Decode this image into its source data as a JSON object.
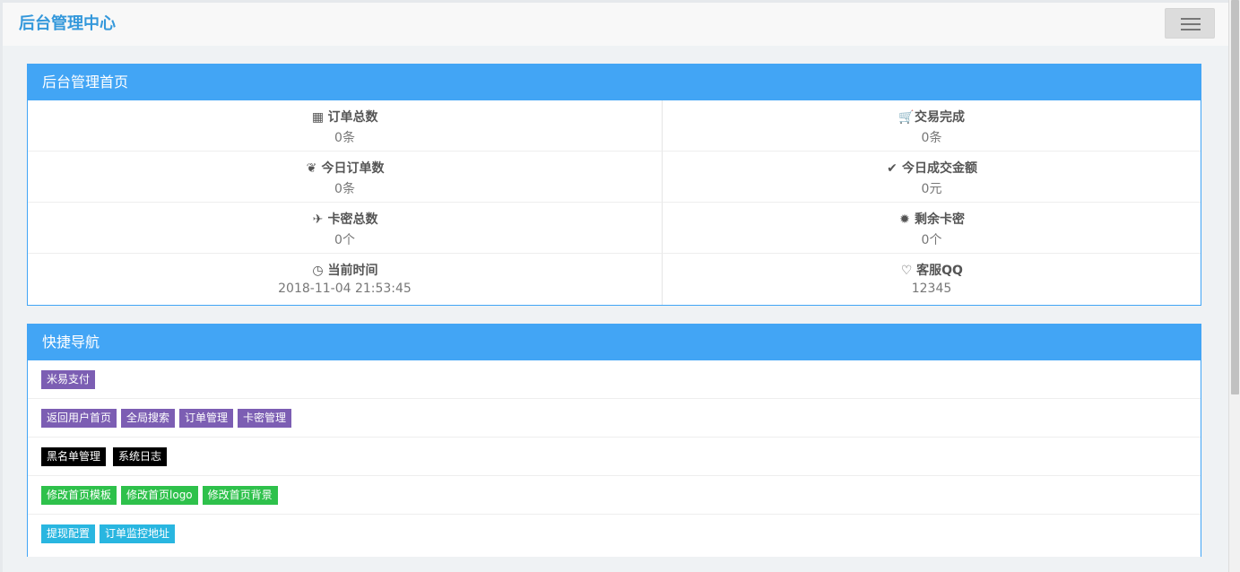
{
  "header": {
    "brand": "后台管理中心"
  },
  "dashboard": {
    "title": "后台管理首页",
    "stats": [
      {
        "icon": "grid-icon",
        "glyph": "▦",
        "label": "订单总数",
        "value": "0条"
      },
      {
        "icon": "cart-icon",
        "glyph": "🛒",
        "label": "交易完成",
        "value": "0条"
      },
      {
        "icon": "leaf-icon",
        "glyph": "❦",
        "label": "今日订单数",
        "value": "0条"
      },
      {
        "icon": "check-icon",
        "glyph": "✔",
        "label": "今日成交金额",
        "value": "0元"
      },
      {
        "icon": "plane-icon",
        "glyph": "✈",
        "label": "卡密总数",
        "value": "0个"
      },
      {
        "icon": "certificate-icon",
        "glyph": "✹",
        "label": "剩余卡密",
        "value": "0个"
      },
      {
        "icon": "clock-icon",
        "glyph": "◷",
        "label": "当前时间",
        "value": "2018-11-04 21:53:45"
      },
      {
        "icon": "heart-icon",
        "glyph": "♡",
        "label": "客服QQ",
        "value": "12345"
      }
    ]
  },
  "quicknav": {
    "title": "快捷导航",
    "rows": [
      [
        {
          "label": "米易支付",
          "color": "purple"
        }
      ],
      [
        {
          "label": "返回用户首页",
          "color": "purple"
        },
        {
          "label": "全局搜索",
          "color": "purple"
        },
        {
          "label": "订单管理",
          "color": "purple"
        },
        {
          "label": "卡密管理",
          "color": "purple"
        }
      ],
      [
        {
          "label": "黑名单管理",
          "color": "black"
        },
        {
          "label": "系统日志",
          "color": "black"
        }
      ],
      [
        {
          "label": "修改首页模板",
          "color": "green"
        },
        {
          "label": "修改首页logo",
          "color": "green"
        },
        {
          "label": "修改首页背景",
          "color": "green"
        }
      ],
      [
        {
          "label": "提现配置",
          "color": "cyan"
        },
        {
          "label": "订单监控地址",
          "color": "cyan"
        }
      ]
    ]
  },
  "colors": {
    "panel": "#42a5f5",
    "purple": "#7c5eb3",
    "black": "#000000",
    "green": "#2ec14b",
    "cyan": "#29b6e0"
  }
}
